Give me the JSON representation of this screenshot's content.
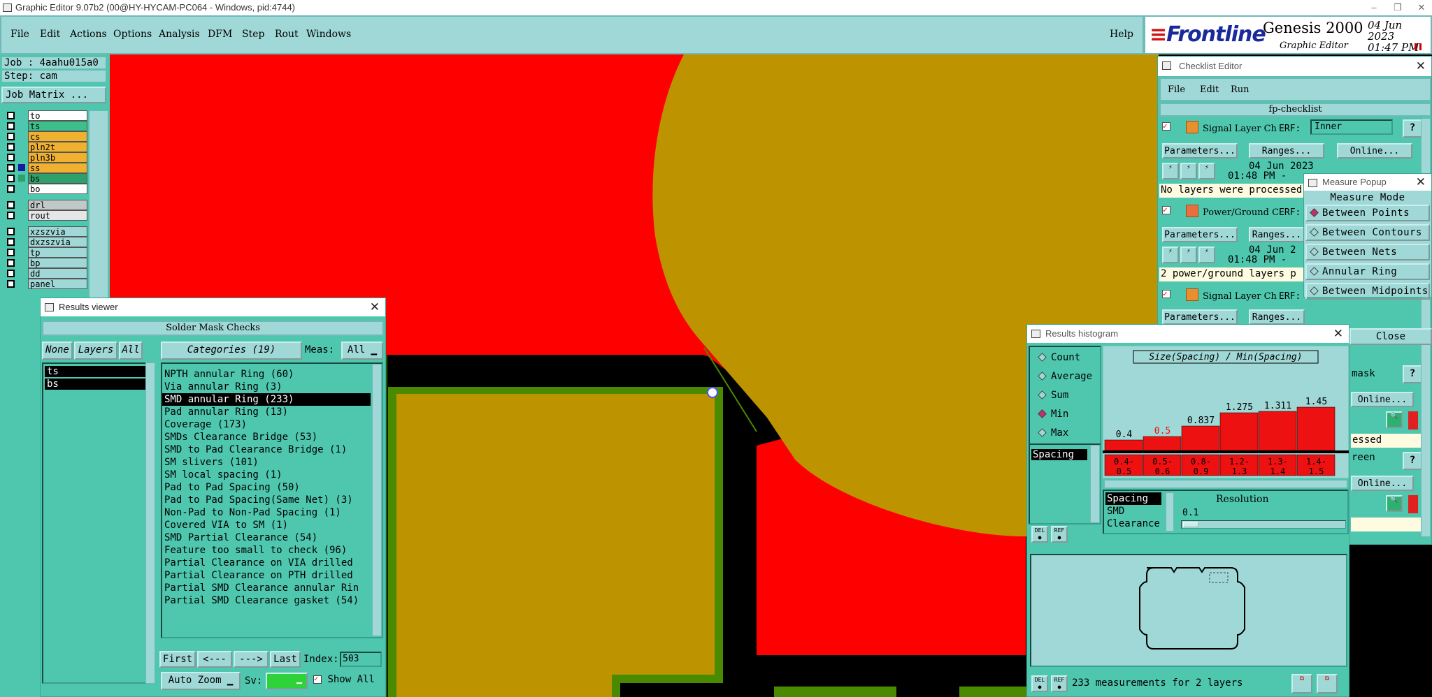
{
  "window": {
    "title": "Graphic Editor 9.07b2 (00@HY-HYCAM-PC064 - Windows, pid:4744)"
  },
  "menu": {
    "items": [
      "File",
      "Edit",
      "Actions",
      "Options",
      "Analysis",
      "DFM",
      "Step",
      "Rout",
      "Windows"
    ],
    "help": "Help"
  },
  "logo": {
    "brand": "Frontline",
    "product": "Genesis 2000",
    "subtitle": "Graphic Editor",
    "date": "04 Jun 2023",
    "time": "01:47 PM"
  },
  "job": {
    "job_label": "Job : 4aahu015a0",
    "step_label": "Step: cam",
    "matrix_button": "Job Matrix ..."
  },
  "layers": [
    {
      "name": "to",
      "color": "#ffffff"
    },
    {
      "name": "ts",
      "color": "#3dbf8c"
    },
    {
      "name": "cs",
      "color": "#f0b030"
    },
    {
      "name": "pln2t",
      "color": "#f0b030"
    },
    {
      "name": "pln3b",
      "color": "#f0b030"
    },
    {
      "name": "ss",
      "color": "#f0b030"
    },
    {
      "name": "bs",
      "color": "#2ea06a"
    },
    {
      "name": "bo",
      "color": "#ffffff"
    },
    {
      "name": "drl",
      "color": "#c0c8c8"
    },
    {
      "name": "rout",
      "color": "#e6e6e6"
    },
    {
      "name": "xzszvia",
      "color": "#9fd8d6"
    },
    {
      "name": "dxzszvia",
      "color": "#9fd8d6"
    },
    {
      "name": "tp",
      "color": "#9fd8d6"
    },
    {
      "name": "bp",
      "color": "#9fd8d6"
    },
    {
      "name": "dd",
      "color": "#9fd8d6"
    },
    {
      "name": "panel",
      "color": "#9fd8d6"
    }
  ],
  "results_viewer": {
    "title": "Results viewer",
    "header": "Solder Mask Checks",
    "none_btn": "None",
    "layers_btn": "Layers",
    "all_btn": "All",
    "categories_btn": "Categories (19)",
    "meas_label": "Meas:",
    "meas_value": "All",
    "layer_list": [
      "ts",
      "bs"
    ],
    "categories": [
      "NPTH annular Ring (60)",
      "Via annular Ring (3)",
      "SMD annular Ring (233)",
      "Pad annular Ring (13)",
      "Coverage (173)",
      "SMDs Clearance Bridge (53)",
      "SMD to Pad Clearance Bridge (1)",
      "SM slivers (101)",
      "SM local spacing (1)",
      "Pad to Pad Spacing (50)",
      "Pad to Pad Spacing(Same Net) (3)",
      "Non-Pad to Non-Pad Spacing (1)",
      "Covered VIA to SM (1)",
      "SMD Partial Clearance (54)",
      "Feature too small to check (96)",
      "Partial Clearance on VIA drilled",
      "Partial Clearance on PTH drilled",
      "Partial SMD Clearance annular Rin",
      "Partial SMD Clearance gasket (54)"
    ],
    "selected_index": 2,
    "nav": {
      "first": "First",
      "prev": "<---",
      "next": "--->",
      "last": "Last",
      "index_label": "Index:",
      "index_value": "503"
    },
    "auto_zoom": "Auto Zoom",
    "sv_label": "Sv:",
    "show_all": "Show All"
  },
  "checklist": {
    "title": "Checklist Editor",
    "menu": [
      "File",
      "Edit",
      "Run"
    ],
    "name": "fp-checklist",
    "items": [
      {
        "label": "Signal Layer Ch",
        "erf": "ERF:",
        "erf_value": "Inner",
        "params": "Parameters...",
        "ranges": "Ranges...",
        "online": "Online...",
        "date": "04 Jun 2023",
        "time": "01:48 PM -",
        "status": "No layers were processed"
      },
      {
        "label": "Power/Ground C",
        "erf": "ERF:",
        "params": "Parameters...",
        "ranges": "Ranges...",
        "date": "04 Jun 2",
        "time": "01:48 PM -",
        "status": "2 power/ground layers p"
      },
      {
        "label": "Signal Layer Ch",
        "erf": "ERF:",
        "params": "Parameters...",
        "ranges": "Ranges..."
      }
    ],
    "right_fragments": {
      "mask": "mask",
      "online": "Online...",
      "essed": "essed",
      "reen": "reen",
      "online2": "Online..."
    }
  },
  "measure": {
    "title": "Measure Popup",
    "mode_label": "Measure Mode",
    "modes": [
      "Between Points",
      "Between Contours",
      "Between Nets",
      "Annular Ring",
      "Between Midpoints"
    ],
    "selected": 0,
    "close": "Close"
  },
  "histogram": {
    "title": "Results histogram",
    "stats": [
      "Count",
      "Average",
      "Sum",
      "Min",
      "Max"
    ],
    "selected_stat": 3,
    "measure_list": [
      "Spacing"
    ],
    "measure_types": [
      "Spacing",
      "SMD",
      "Clearance"
    ],
    "resolution_label": "Resolution",
    "resolution_value": "0.1",
    "summary": "233 measurements for 2 layers",
    "del": "DEL",
    "ref": "REF"
  },
  "chart_data": {
    "type": "bar",
    "title": "Size(Spacing) / Min(Spacing)",
    "categories": [
      "0.4-0.5",
      "0.5-0.6",
      "0.8-0.9",
      "1.2-1.3",
      "1.3-1.4",
      "1.4-1.5"
    ],
    "values": [
      0.4,
      0.5,
      0.837,
      1.275,
      1.311,
      1.45
    ],
    "labels": [
      "0.4",
      "0.5",
      "0.837",
      "1.275",
      "1.311",
      "1.45"
    ],
    "bar_color": "#ee1111",
    "highlight_label_color": "#ee1111"
  },
  "colors": {
    "panel": "#4fc7ae",
    "bar": "#9fd8d6",
    "copper_red": "#ff0000",
    "copper_gold": "#bd9400",
    "mask_green": "#4a8a00"
  }
}
